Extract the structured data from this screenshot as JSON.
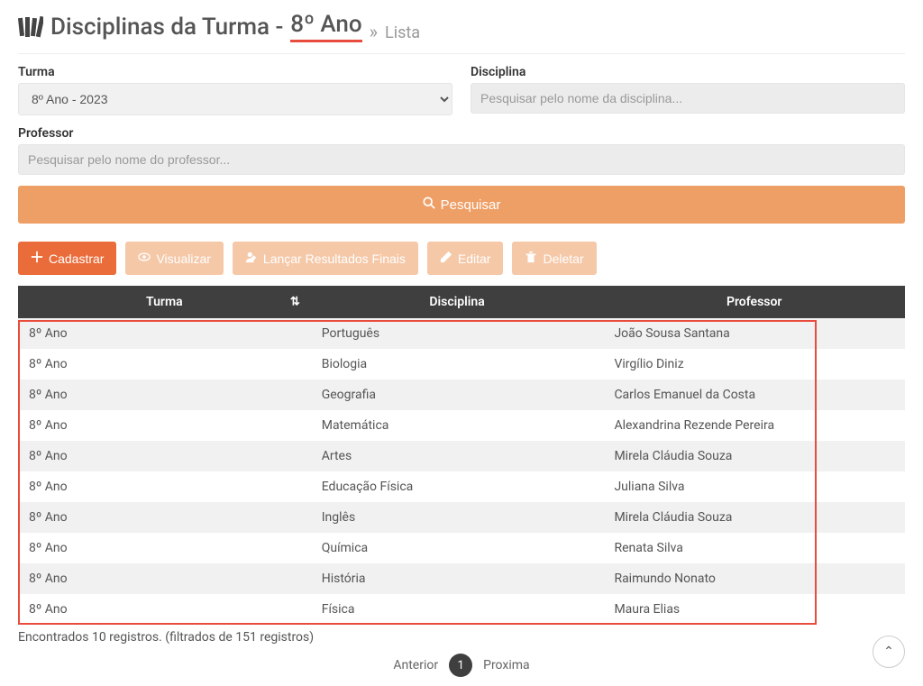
{
  "header": {
    "title_prefix": "Disciplinas da Turma -",
    "title_highlight": "8º Ano",
    "breadcrumb": "Lista"
  },
  "filters": {
    "turma_label": "Turma",
    "turma_value": "8º Ano - 2023",
    "disciplina_label": "Disciplina",
    "disciplina_placeholder": "Pesquisar pelo nome da disciplina...",
    "professor_label": "Professor",
    "professor_placeholder": "Pesquisar pelo nome do professor...",
    "search_button": "Pesquisar"
  },
  "actions": {
    "cadastrar": "Cadastrar",
    "visualizar": "Visualizar",
    "lancar": "Lançar Resultados Finais",
    "editar": "Editar",
    "deletar": "Deletar"
  },
  "table": {
    "headers": {
      "turma": "Turma",
      "disciplina": "Disciplina",
      "professor": "Professor"
    },
    "rows": [
      {
        "turma": "8º Ano",
        "disciplina": "Português",
        "professor": "João Sousa Santana"
      },
      {
        "turma": "8º Ano",
        "disciplina": "Biologia",
        "professor": "Virgílio Diniz"
      },
      {
        "turma": "8º Ano",
        "disciplina": "Geografia",
        "professor": "Carlos Emanuel da Costa"
      },
      {
        "turma": "8º Ano",
        "disciplina": "Matemática",
        "professor": "Alexandrina Rezende Pereira"
      },
      {
        "turma": "8º Ano",
        "disciplina": "Artes",
        "professor": "Mirela Cláudia Souza"
      },
      {
        "turma": "8º Ano",
        "disciplina": "Educação Física",
        "professor": "Juliana Silva"
      },
      {
        "turma": "8º Ano",
        "disciplina": "Inglês",
        "professor": "Mirela Cláudia Souza"
      },
      {
        "turma": "8º Ano",
        "disciplina": "Química",
        "professor": "Renata Silva"
      },
      {
        "turma": "8º Ano",
        "disciplina": "História",
        "professor": "Raimundo Nonato"
      },
      {
        "turma": "8º Ano",
        "disciplina": "Física",
        "professor": "Maura Elias"
      }
    ]
  },
  "footer": {
    "info": "Encontrados 10 registros. (filtrados de 151 registros)",
    "prev": "Anterior",
    "page": "1",
    "next": "Proxima"
  }
}
